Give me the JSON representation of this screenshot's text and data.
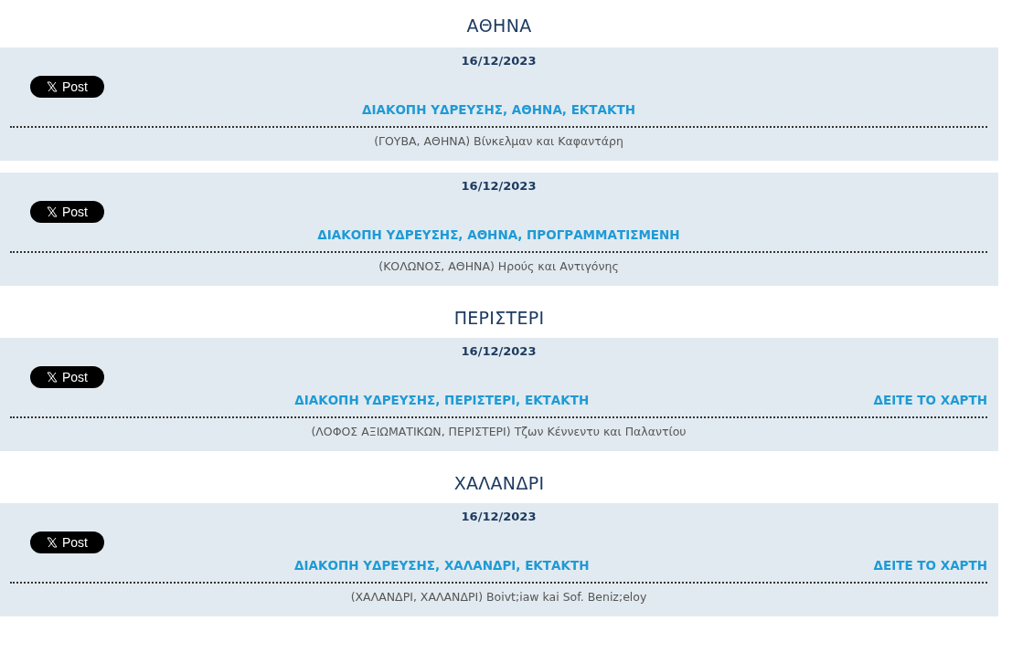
{
  "sections": [
    {
      "name": "ΑΘΗΝΑ",
      "notices": [
        {
          "date": "16/12/2023",
          "post_label": "Post",
          "title": "ΔΙΑΚΟΠΗ ΥΔΡΕΥΣΗΣ, ΑΘΗΝΑ, ΕΚΤΑΚΤΗ",
          "address": "(ΓΟΥΒΑ, ΑΘΗΝΑ) Βίνκελμαν και Καφαντάρη"
        },
        {
          "date": "16/12/2023",
          "post_label": "Post",
          "title": "ΔΙΑΚΟΠΗ ΥΔΡΕΥΣΗΣ, ΑΘΗΝΑ, ΠΡΟΓΡΑΜΜΑΤΙΣΜΕΝΗ",
          "address": "(ΚΟΛΩΝΟΣ, ΑΘΗΝΑ) Ηρούς και Αντιγόνης"
        }
      ]
    },
    {
      "name": "ΠΕΡΙΣΤΕΡΙ",
      "notices": [
        {
          "date": "16/12/2023",
          "post_label": "Post",
          "title": "ΔΙΑΚΟΠΗ ΥΔΡΕΥΣΗΣ, ΠΕΡΙΣΤΕΡΙ, ΕΚΤΑΚΤΗ",
          "map_link": "ΔΕΙΤΕ ΤΟ ΧΑΡΤΗ",
          "address": "(ΛΟΦΟΣ ΑΞΙΩΜΑΤΙΚΩΝ, ΠΕΡΙΣΤΕΡΙ) Τζων Κέννεντυ και Παλαντίου"
        }
      ]
    },
    {
      "name": "ΧΑΛΑΝΔΡΙ",
      "notices": [
        {
          "date": "16/12/2023",
          "post_label": "Post",
          "title": "ΔΙΑΚΟΠΗ ΥΔΡΕΥΣΗΣ, ΧΑΛΑΝΔΡΙ, ΕΚΤΑΚΤΗ",
          "map_link": "ΔΕΙΤΕ ΤΟ ΧΑΡΤΗ",
          "address": "(ΧΑΛΑΝΔΡΙ, ΧΑΛΑΝΔΡΙ) Boivt;iaw kai Sof. Beniz;eloy"
        }
      ]
    }
  ]
}
